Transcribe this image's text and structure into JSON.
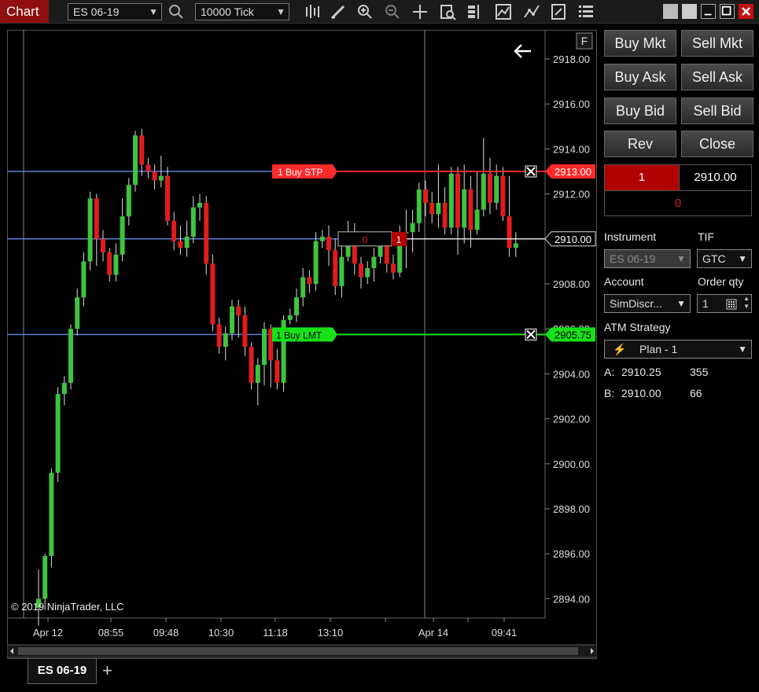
{
  "window": {
    "title": "Chart"
  },
  "toolbar": {
    "instrument": "ES 06-19",
    "interval": "10000 Tick"
  },
  "chart": {
    "price_ticks": [
      "2918.00",
      "2916.00",
      "2914.00",
      "2912.00",
      "2910.00",
      "2908.00",
      "2906.00",
      "2904.00",
      "2902.00",
      "2900.00",
      "2898.00",
      "2896.00",
      "2894.00"
    ],
    "time_ticks": [
      "Apr 12",
      "08:55",
      "09:48",
      "10:30",
      "11:18",
      "13:10",
      "Apr 14",
      "09:41"
    ],
    "copyright": "© 2019 NinjaTrader, LLC",
    "f_button": "F",
    "orders": {
      "stop": {
        "qty": "1",
        "label": "Buy STP",
        "price": "2913.00"
      },
      "limit": {
        "qty": "1",
        "label": "Buy LMT",
        "price": "2905.75"
      },
      "position": {
        "pnl": "0",
        "qty": "1",
        "price": "2910.00"
      }
    },
    "candles": [
      [
        2893.6,
        2894.0,
        2892.8,
        2895.3
      ],
      [
        2894.0,
        2895.9,
        2893.5,
        2896.0
      ],
      [
        2895.9,
        2899.6,
        2895.4,
        2899.8
      ],
      [
        2899.6,
        2903.1,
        2899.2,
        2903.4
      ],
      [
        2903.1,
        2903.6,
        2902.6,
        2903.9
      ],
      [
        2903.6,
        2906.0,
        2903.3,
        2906.2
      ],
      [
        2906.0,
        2907.4,
        2905.7,
        2907.8
      ],
      [
        2907.4,
        2909.0,
        2907.0,
        2909.4
      ],
      [
        2909.0,
        2911.8,
        2908.6,
        2912.1
      ],
      [
        2911.8,
        2910.0,
        2908.8,
        2912.0
      ],
      [
        2910.0,
        2909.4,
        2909.0,
        2910.4
      ],
      [
        2909.4,
        2908.4,
        2908.1,
        2909.6
      ],
      [
        2908.4,
        2909.3,
        2908.1,
        2909.8
      ],
      [
        2909.3,
        2911.0,
        2909.0,
        2911.8
      ],
      [
        2911.0,
        2912.4,
        2910.6,
        2912.7
      ],
      [
        2912.4,
        2914.6,
        2912.1,
        2914.8
      ],
      [
        2914.6,
        2913.3,
        2912.8,
        2914.9
      ],
      [
        2913.3,
        2913.0,
        2912.7,
        2913.6
      ],
      [
        2913.0,
        2912.6,
        2912.2,
        2913.3
      ],
      [
        2912.6,
        2912.8,
        2912.3,
        2913.7
      ],
      [
        2912.8,
        2910.8,
        2910.6,
        2913.2
      ],
      [
        2910.8,
        2909.9,
        2909.5,
        2911.2
      ],
      [
        2909.9,
        2909.6,
        2909.3,
        2910.6
      ],
      [
        2909.6,
        2910.1,
        2909.2,
        2910.8
      ],
      [
        2910.1,
        2911.4,
        2909.8,
        2911.9
      ],
      [
        2911.4,
        2911.6,
        2910.8,
        2912.0
      ],
      [
        2911.6,
        2908.9,
        2908.4,
        2911.9
      ],
      [
        2908.9,
        2906.2,
        2905.9,
        2909.3
      ],
      [
        2906.2,
        2905.2,
        2904.9,
        2906.5
      ],
      [
        2905.2,
        2905.8,
        2904.6,
        2906.1
      ],
      [
        2905.8,
        2907.0,
        2905.5,
        2907.3
      ],
      [
        2907.0,
        2906.6,
        2905.6,
        2907.3
      ],
      [
        2906.6,
        2905.2,
        2904.8,
        2907.0
      ],
      [
        2905.2,
        2903.6,
        2903.3,
        2905.4
      ],
      [
        2903.6,
        2904.4,
        2902.6,
        2904.7
      ],
      [
        2904.4,
        2906.0,
        2903.5,
        2906.3
      ],
      [
        2906.0,
        2904.6,
        2903.4,
        2906.2
      ],
      [
        2904.6,
        2903.6,
        2903.3,
        2905.1
      ],
      [
        2903.6,
        2906.4,
        2903.2,
        2906.6
      ],
      [
        2906.4,
        2906.6,
        2906.2,
        2906.9
      ],
      [
        2906.6,
        2907.4,
        2906.3,
        2907.8
      ],
      [
        2907.4,
        2908.3,
        2907.0,
        2908.7
      ],
      [
        2908.3,
        2908.0,
        2907.6,
        2908.6
      ],
      [
        2908.0,
        2909.9,
        2907.7,
        2910.3
      ],
      [
        2909.9,
        2910.1,
        2909.6,
        2910.4
      ],
      [
        2910.1,
        2909.5,
        2908.8,
        2910.6
      ],
      [
        2909.5,
        2907.9,
        2907.5,
        2910.0
      ],
      [
        2907.9,
        2909.2,
        2907.4,
        2909.7
      ],
      [
        2909.2,
        2910.3,
        2909.0,
        2910.8
      ],
      [
        2910.3,
        2908.9,
        2908.4,
        2910.7
      ],
      [
        2908.9,
        2908.3,
        2907.8,
        2909.2
      ],
      [
        2908.3,
        2908.7,
        2908.0,
        2909.0
      ],
      [
        2908.7,
        2909.2,
        2908.1,
        2909.6
      ],
      [
        2909.2,
        2909.8,
        2908.9,
        2910.1
      ],
      [
        2909.8,
        2908.9,
        2908.5,
        2910.1
      ],
      [
        2908.9,
        2908.5,
        2908.2,
        2909.3
      ],
      [
        2908.5,
        2910.3,
        2908.3,
        2910.6
      ],
      [
        2910.3,
        2910.3,
        2908.7,
        2911.3
      ],
      [
        2910.3,
        2910.7,
        2909.4,
        2911.3
      ],
      [
        2910.7,
        2912.2,
        2910.3,
        2912.5
      ],
      [
        2912.2,
        2911.6,
        2911.0,
        2912.6
      ],
      [
        2911.6,
        2911.1,
        2910.7,
        2912.1
      ],
      [
        2911.1,
        2911.6,
        2910.5,
        2913.3
      ],
      [
        2911.6,
        2910.5,
        2910.2,
        2912.3
      ],
      [
        2910.5,
        2912.9,
        2910.2,
        2913.2
      ],
      [
        2912.9,
        2910.5,
        2909.3,
        2913.2
      ],
      [
        2910.5,
        2912.2,
        2909.8,
        2913.3
      ],
      [
        2912.2,
        2910.4,
        2909.6,
        2912.8
      ],
      [
        2910.4,
        2911.3,
        2910.2,
        2913.0
      ],
      [
        2911.3,
        2912.9,
        2911.0,
        2914.5
      ],
      [
        2912.9,
        2911.6,
        2911.1,
        2913.6
      ],
      [
        2911.6,
        2912.8,
        2911.3,
        2913.3
      ],
      [
        2912.8,
        2911.0,
        2910.8,
        2913.2
      ],
      [
        2911.0,
        2909.6,
        2909.2,
        2912.8
      ],
      [
        2909.6,
        2909.8,
        2909.2,
        2910.3
      ]
    ]
  },
  "panel": {
    "buttons": [
      "Buy Mkt",
      "Sell Mkt",
      "Buy Ask",
      "Sell Ask",
      "Buy Bid",
      "Sell Bid",
      "Rev",
      "Close"
    ],
    "order_qty_display": "1",
    "order_price_display": "2910.00",
    "position_display": "0",
    "instrument_label": "Instrument",
    "tif_label": "TIF",
    "instrument_value": "ES 06-19",
    "tif_value": "GTC",
    "account_label": "Account",
    "order_qty_label": "Order qty",
    "account_value": "SimDiscr...",
    "order_qty_value": "1",
    "atm_label": "ATM Strategy",
    "atm_value": "Plan - 1",
    "ask_label": "A:",
    "ask_price": "2910.25",
    "ask_size": "355",
    "bid_label": "B:",
    "bid_price": "2910.00",
    "bid_size": "66"
  },
  "tabs": [
    {
      "label": "ES 06-19"
    }
  ],
  "colors": {
    "up": "#3ec43e",
    "down": "#e01c1c",
    "stop": "#ff2a2a",
    "limit": "#18e018",
    "hline": "#5a7fd6",
    "panel_red": "#b00000"
  }
}
